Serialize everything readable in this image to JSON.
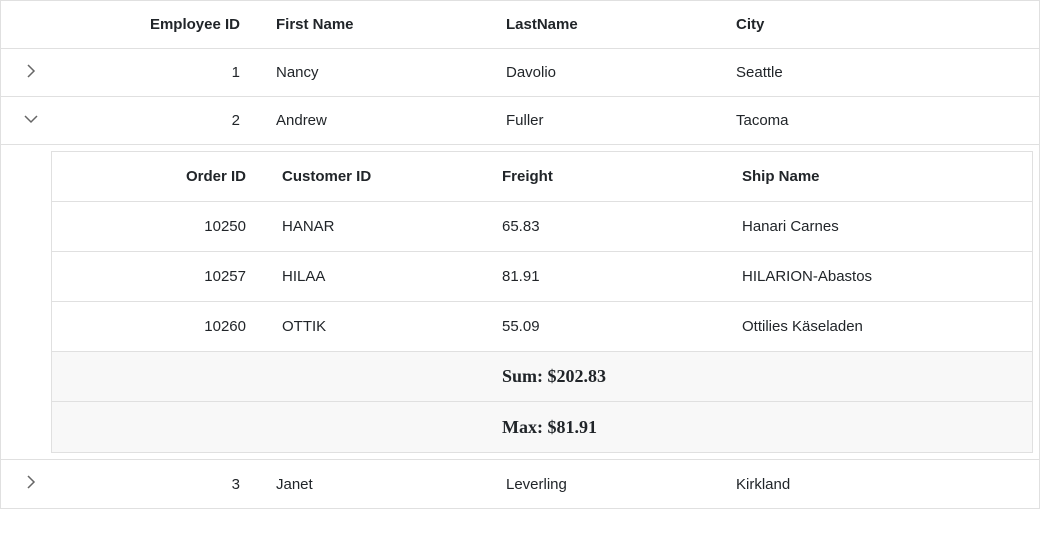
{
  "master": {
    "columns": {
      "employee_id": "Employee ID",
      "first_name": "First Name",
      "last_name": "LastName",
      "city": "City"
    },
    "rows": [
      {
        "expanded": false,
        "employee_id": "1",
        "first_name": "Nancy",
        "last_name": "Davolio",
        "city": "Seattle"
      },
      {
        "expanded": true,
        "employee_id": "2",
        "first_name": "Andrew",
        "last_name": "Fuller",
        "city": "Tacoma"
      },
      {
        "expanded": false,
        "employee_id": "3",
        "first_name": "Janet",
        "last_name": "Leverling",
        "city": "Kirkland"
      }
    ]
  },
  "detail": {
    "columns": {
      "order_id": "Order ID",
      "customer_id": "Customer ID",
      "freight": "Freight",
      "ship_name": "Ship Name"
    },
    "rows": [
      {
        "order_id": "10250",
        "customer_id": "HANAR",
        "freight": "65.83",
        "ship_name": "Hanari Carnes"
      },
      {
        "order_id": "10257",
        "customer_id": "HILAA",
        "freight": "81.91",
        "ship_name": "HILARION-Abastos"
      },
      {
        "order_id": "10260",
        "customer_id": "OTTIK",
        "freight": "55.09",
        "ship_name": "Ottilies Käseladen"
      }
    ],
    "summaries": [
      {
        "text": "Sum: $202.83"
      },
      {
        "text": "Max: $81.91"
      }
    ]
  }
}
